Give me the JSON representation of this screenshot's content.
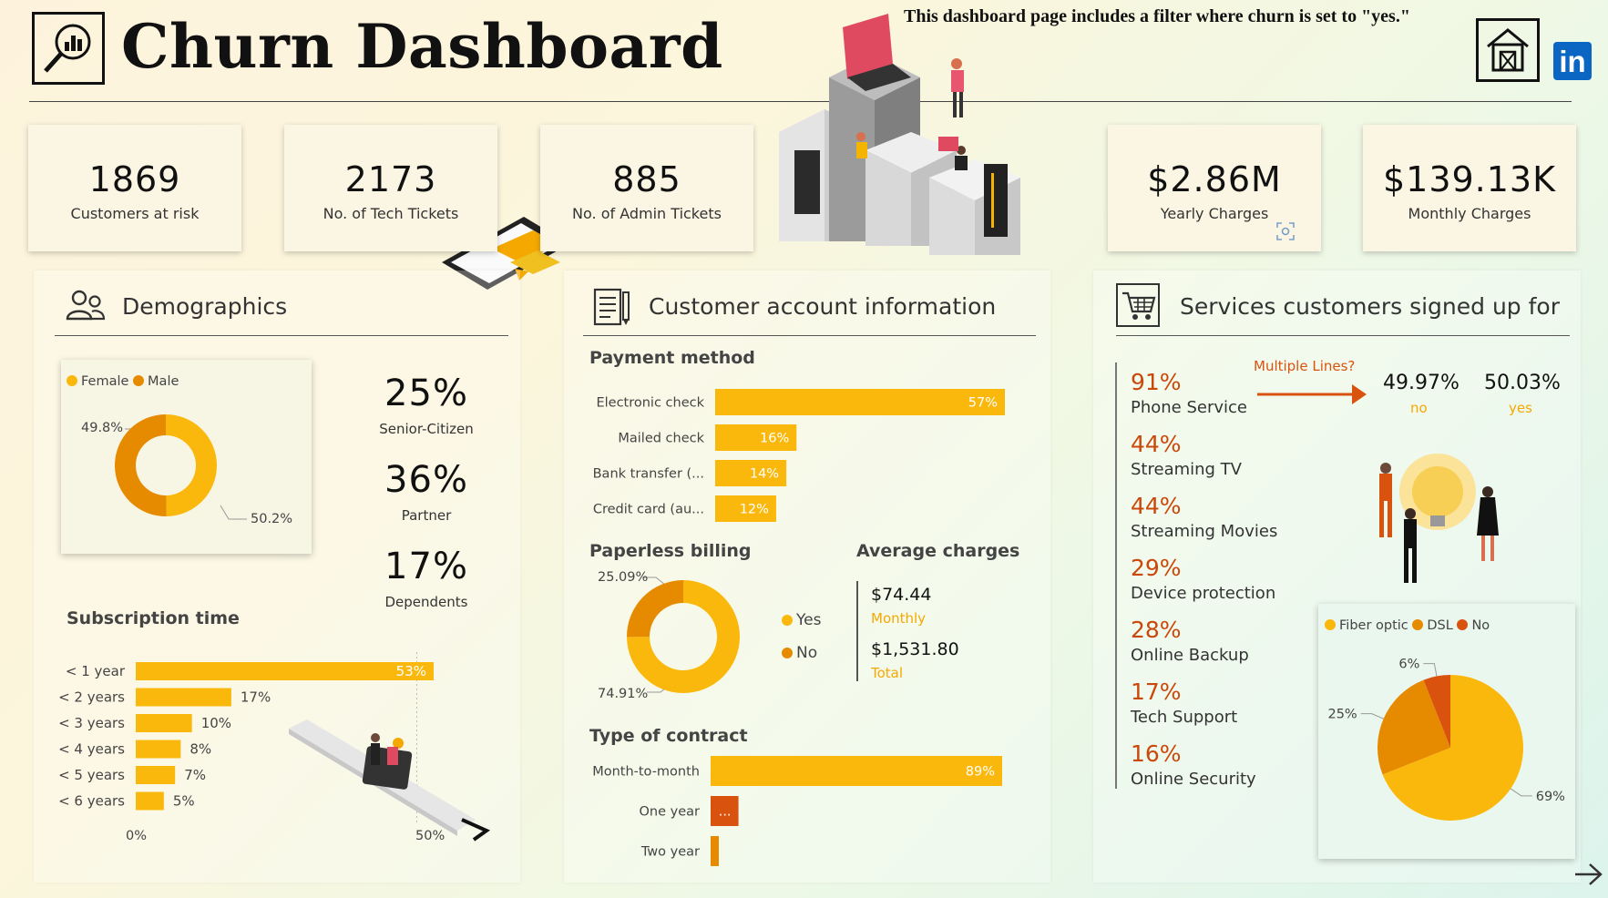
{
  "header": {
    "title": "Churn Dashboard",
    "filter_note": "This dashboard page includes a filter where churn is set to \"yes.\"",
    "linkedin_label": "in"
  },
  "kpis": [
    {
      "value": "1869",
      "label": "Customers at risk"
    },
    {
      "value": "2173",
      "label": "No. of Tech Tickets"
    },
    {
      "value": "885",
      "label": "No. of Admin Tickets"
    },
    {
      "value": "$2.86M",
      "label": "Yearly Charges"
    },
    {
      "value": "$139.13K",
      "label": "Monthly Charges"
    }
  ],
  "demographics": {
    "title": "Demographics",
    "gender_legend": [
      "Female",
      "Male"
    ],
    "gender_labels": [
      "49.8%",
      "50.2%"
    ],
    "stats": [
      {
        "value": "25%",
        "label": "Senior-Citizen"
      },
      {
        "value": "36%",
        "label": "Partner"
      },
      {
        "value": "17%",
        "label": "Dependents"
      }
    ],
    "subscription_title": "Subscription time",
    "axis_min_label": "0%",
    "axis_max_label": "50%"
  },
  "account": {
    "title": "Customer account information",
    "payment_title": "Payment method",
    "paperless_title": "Paperless billing",
    "paperless_legend": [
      "Yes",
      "No"
    ],
    "paperless_labels": [
      "25.09%",
      "74.91%"
    ],
    "avg_title": "Average charges",
    "avg_monthly_value": "$74.44",
    "avg_monthly_label": "Monthly",
    "avg_total_value": "$1,531.80",
    "avg_total_label": "Total",
    "contract_title": "Type of contract"
  },
  "services": {
    "title": "Services customers signed up for",
    "multiple_lines_label": "Multiple Lines?",
    "no_pct": "49.97%",
    "no_label": "no",
    "yes_pct": "50.03%",
    "yes_label": "yes",
    "items": [
      {
        "pct": "91%",
        "label": "Phone Service"
      },
      {
        "pct": "44%",
        "label": "Streaming TV"
      },
      {
        "pct": "44%",
        "label": "Streaming Movies"
      },
      {
        "pct": "29%",
        "label": "Device protection"
      },
      {
        "pct": "28%",
        "label": "Online Backup"
      },
      {
        "pct": "17%",
        "label": "Tech Support"
      },
      {
        "pct": "16%",
        "label": "Online Security"
      }
    ],
    "internet_legend": [
      "Fiber optic",
      "DSL",
      "No"
    ]
  },
  "colors": {
    "accent": "#fbb80c",
    "dark_orange": "#e68a00",
    "deep_orange": "#d9530f",
    "red_text": "#c9480a"
  },
  "chart_data": [
    {
      "type": "pie",
      "name": "gender",
      "categories": [
        "Female",
        "Male"
      ],
      "values": [
        49.8,
        50.2
      ],
      "donut": true
    },
    {
      "type": "bar",
      "name": "subscription_time",
      "orientation": "horizontal",
      "categories": [
        "< 1 year",
        "< 2 years",
        "< 3 years",
        "< 4 years",
        "< 5 years",
        "< 6 years"
      ],
      "values": [
        53,
        17,
        10,
        8,
        7,
        5
      ],
      "data_labels": [
        "53%",
        "17%",
        "10%",
        "8%",
        "7%",
        "5%"
      ],
      "xlim": [
        0,
        50
      ]
    },
    {
      "type": "bar",
      "name": "payment_method",
      "orientation": "horizontal",
      "categories": [
        "Electronic check",
        "Mailed check",
        "Bank transfer (...",
        "Credit card (au..."
      ],
      "values": [
        57,
        16,
        14,
        12
      ],
      "data_labels": [
        "57%",
        "16%",
        "14%",
        "12%"
      ]
    },
    {
      "type": "pie",
      "name": "paperless_billing",
      "categories": [
        "Yes",
        "No"
      ],
      "values": [
        74.91,
        25.09
      ],
      "donut": true
    },
    {
      "type": "bar",
      "name": "contract",
      "orientation": "horizontal",
      "categories": [
        "Month-to-month",
        "One year",
        "Two year"
      ],
      "values": [
        89,
        8.5,
        2.5
      ],
      "data_labels": [
        "89%",
        "...",
        ""
      ]
    },
    {
      "type": "pie",
      "name": "internet_service",
      "categories": [
        "Fiber optic",
        "DSL",
        "No"
      ],
      "values": [
        69,
        25,
        6
      ],
      "data_labels": [
        "69%",
        "25%",
        "6%"
      ]
    }
  ]
}
